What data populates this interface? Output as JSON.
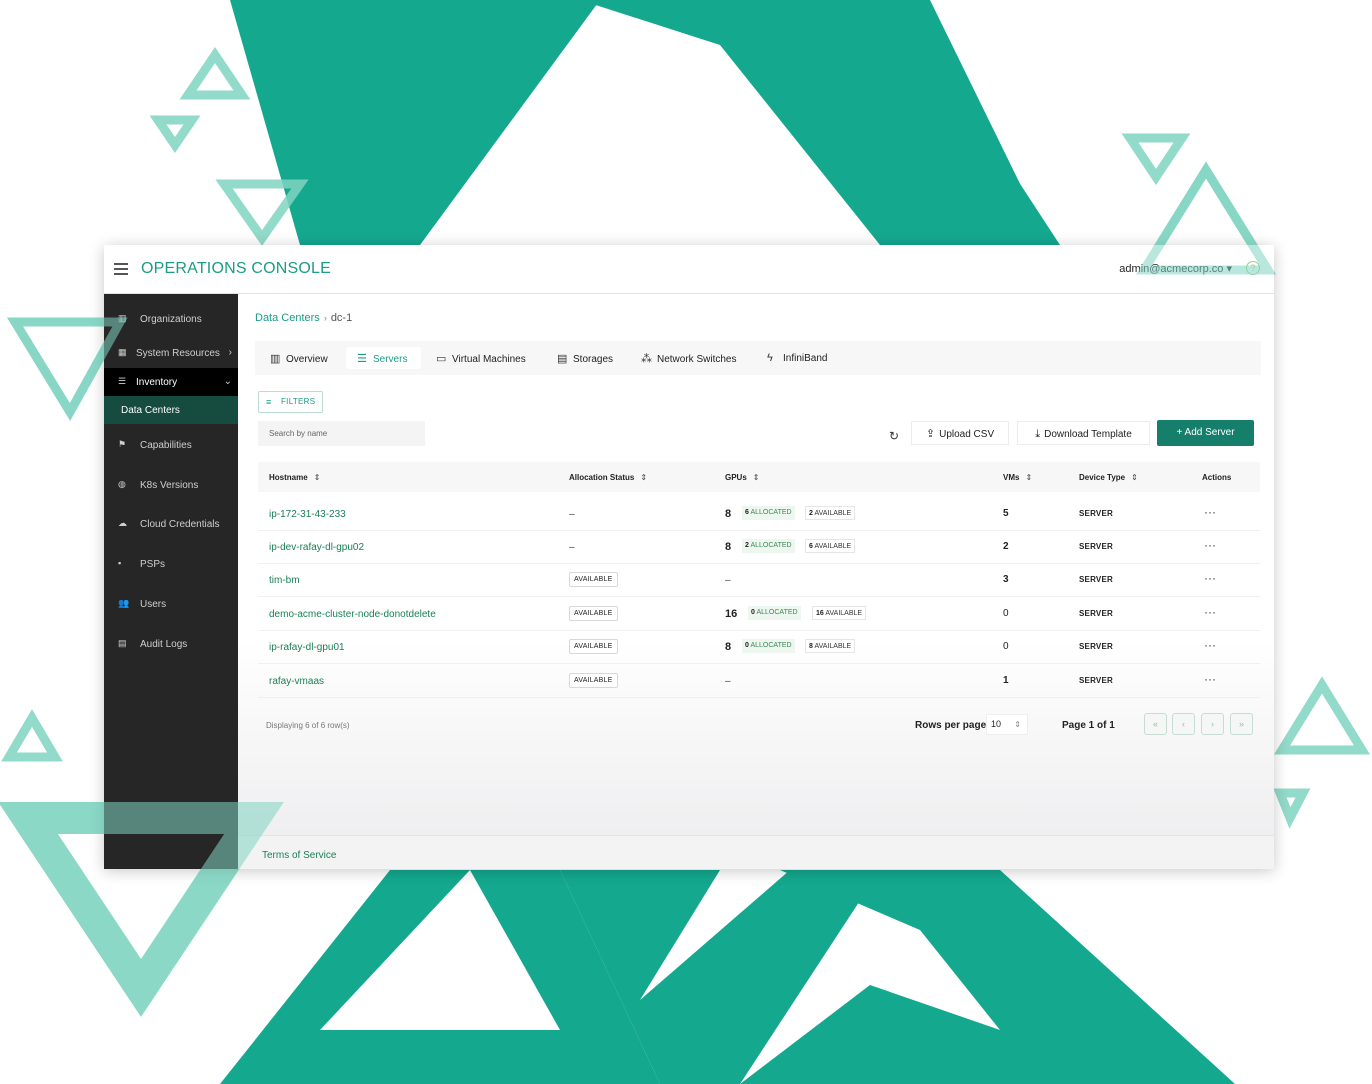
{
  "header": {
    "title": "OPERATIONS CONSOLE",
    "user": "admin@acmecorp.co",
    "user_caret": "▾",
    "help": "?"
  },
  "sidebar": {
    "items": [
      {
        "label": "Organizations"
      },
      {
        "label": "System Resources"
      },
      {
        "label": "Inventory"
      },
      {
        "label": "Data Centers"
      },
      {
        "label": "Capabilities"
      },
      {
        "label": "K8s Versions"
      },
      {
        "label": "Cloud Credentials"
      },
      {
        "label": "PSPs"
      },
      {
        "label": "Users"
      },
      {
        "label": "Audit Logs"
      }
    ]
  },
  "breadcrumb": {
    "parent": "Data Centers",
    "separator": "›",
    "current": "dc-1"
  },
  "tabs": [
    {
      "label": "Overview"
    },
    {
      "label": "Servers"
    },
    {
      "label": "Virtual Machines"
    },
    {
      "label": "Storages"
    },
    {
      "label": "Network Switches"
    },
    {
      "label": "InfiniBand"
    }
  ],
  "toolbar": {
    "filters_label": "FILTERS",
    "search_placeholder": "Search by name",
    "upload_label": "Upload CSV",
    "download_label": "Download Template",
    "add_label": "+ Add Server"
  },
  "table": {
    "columns": [
      "Hostname",
      "Allocation Status",
      "GPUs",
      "VMs",
      "Device Type",
      "Actions"
    ],
    "rows": [
      {
        "hostname": "ip-172-31-43-233",
        "status": "–",
        "gpus": "8",
        "allocated": "6",
        "available": "2",
        "vms": "5",
        "type": "SERVER"
      },
      {
        "hostname": "ip-dev-rafay-dl-gpu02",
        "status": "–",
        "gpus": "8",
        "allocated": "2",
        "available": "6",
        "vms": "2",
        "type": "SERVER"
      },
      {
        "hostname": "tim-bm",
        "status": "AVAILABLE",
        "gpus": "–",
        "allocated": "",
        "available": "",
        "vms": "3",
        "type": "SERVER"
      },
      {
        "hostname": "demo-acme-cluster-node-donotdelete",
        "status": "AVAILABLE",
        "gpus": "16",
        "allocated": "0",
        "available": "16",
        "vms": "0",
        "type": "SERVER"
      },
      {
        "hostname": "ip-rafay-dl-gpu01",
        "status": "AVAILABLE",
        "gpus": "8",
        "allocated": "0",
        "available": "8",
        "vms": "0",
        "type": "SERVER"
      },
      {
        "hostname": "rafay-vmaas",
        "status": "AVAILABLE",
        "gpus": "–",
        "allocated": "",
        "available": "",
        "vms": "1",
        "type": "SERVER"
      }
    ],
    "allocated_word": "ALLOCATED",
    "available_word": "AVAILABLE",
    "actions_glyph": "···"
  },
  "footer": {
    "displaying": "Displaying 6 of 6 row(s)",
    "rows_per_page_label": "Rows per page",
    "rows_per_page_value": "10",
    "page_info": "Page 1 of 1",
    "terms": "Terms of Service"
  },
  "colors": {
    "brand": "#1a9c86",
    "teal_bg": "#14a88f",
    "teal_light": "#7fd4c1",
    "add_button": "#157f6c"
  },
  "icons": [
    "menu-icon",
    "help-icon",
    "bank-icon",
    "resources-icon",
    "list-icon",
    "flag-icon",
    "globe-icon",
    "cloud-icon",
    "grid-icon",
    "users-icon",
    "calendar-icon",
    "building-icon",
    "server-icon",
    "monitor-icon",
    "database-icon",
    "network-icon",
    "bolt-icon",
    "filter-icon",
    "refresh-icon",
    "upload-icon",
    "download-icon",
    "sort-icon"
  ]
}
